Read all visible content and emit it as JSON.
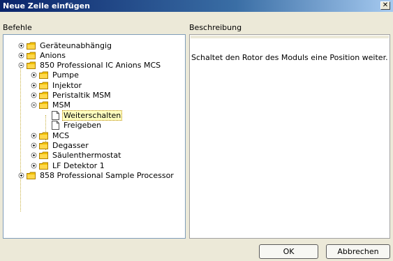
{
  "window": {
    "title": "Neue Zeile einfügen"
  },
  "labels": {
    "commands": "Befehle",
    "description": "Beschreibung"
  },
  "tree": [
    {
      "label": "Geräteunabhängig"
    },
    {
      "label": "Anions"
    },
    {
      "label": "850 Professional IC Anions MCS"
    },
    {
      "label": "Pumpe"
    },
    {
      "label": "Injektor"
    },
    {
      "label": "Peristaltik MSM"
    },
    {
      "label": "MSM"
    },
    {
      "label": "Weiterschalten"
    },
    {
      "label": "Freigeben"
    },
    {
      "label": "MCS"
    },
    {
      "label": "Degasser"
    },
    {
      "label": "Säulenthermostat"
    },
    {
      "label": "LF Detektor 1"
    },
    {
      "label": "858 Professional Sample Processor"
    }
  ],
  "description_text": "Schaltet den Rotor des Moduls eine Position weiter.",
  "buttons": {
    "ok": "OK",
    "cancel": "Abbrechen"
  },
  "colors": {
    "selection": "#ffffbf",
    "folder": "#f0c000"
  }
}
